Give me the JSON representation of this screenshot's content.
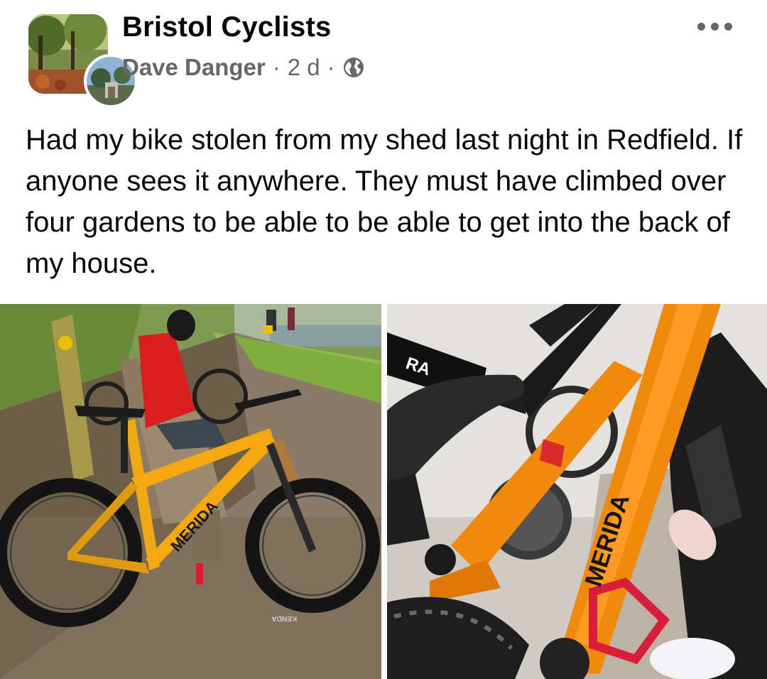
{
  "header": {
    "group_name": "Bristol Cyclists",
    "author": "Dave Danger",
    "separator": "·",
    "time_ago": "2 d",
    "privacy_icon": "globe-icon",
    "more_icon": "more-options-icon"
  },
  "post": {
    "text": "Had my bike stolen from my shed last night in Redfield. If anyone sees it anywhere. They must have climbed over four gardens to be able to be able to get into the back of my house."
  },
  "photos": {
    "left": {
      "frame_text": "MERIDA",
      "tyre_text": "KENDA"
    },
    "right": {
      "frame_text": "MERIDA",
      "bg_bike_text": "RA"
    }
  },
  "colors": {
    "text_primary": "#050505",
    "text_secondary": "#65676b",
    "bike_orange": "#f08a0c"
  }
}
